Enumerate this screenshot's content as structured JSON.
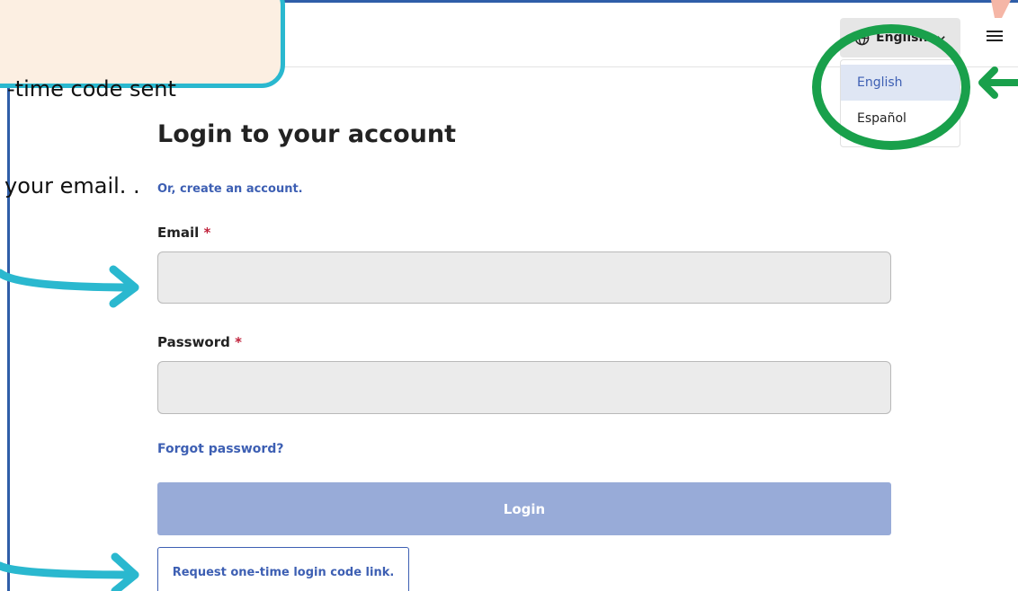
{
  "callout": {
    "line1": "-time code sent",
    "line2": "your email. ."
  },
  "header": {
    "language_button_label": "English",
    "language_menu": [
      "English",
      "Español"
    ],
    "selected_language": "English"
  },
  "form": {
    "title": "Login to your account",
    "create_account_link": "Or, create an account.",
    "email_label": "Email",
    "password_label": "Password",
    "required_marker": "*",
    "forgot_password_link": "Forgot password?",
    "login_button": "Login",
    "request_code_button": "Request one-time login code link."
  },
  "icons": {
    "globe": "globe-icon",
    "chevron": "chevron-down-icon",
    "menu": "hamburger-menu-icon"
  },
  "colors": {
    "accent_blue": "#3d5fb3",
    "login_button": "#98abd8",
    "annotation_cyan": "#2ab8cf",
    "annotation_green": "#19a04b",
    "callout_fill": "#fcefe2",
    "required_red": "#c0223b"
  }
}
